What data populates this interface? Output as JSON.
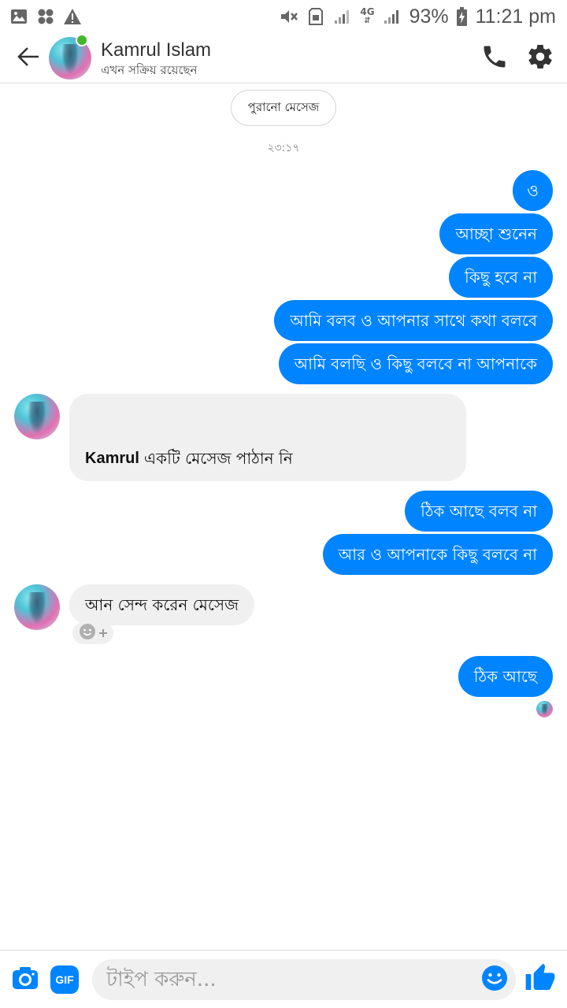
{
  "status_bar": {
    "battery": "93%",
    "time": "11:21 pm",
    "network": "4G",
    "icons": [
      "image-icon",
      "apps-icon",
      "warning-icon",
      "mute-icon",
      "sim-icon",
      "signal-icon",
      "signal-4g-icon",
      "battery-icon"
    ]
  },
  "header": {
    "name": "Kamrul Islam",
    "status": "এখন সক্রিয় রয়েছেন",
    "icons": [
      "back-arrow-icon",
      "phone-icon",
      "gear-icon"
    ]
  },
  "chat": {
    "older_messages_label": "পুরানো মেসেজ",
    "timestamp": "২৩:১৭",
    "messages": [
      {
        "text": "ও"
      },
      {
        "text": "আচ্ছা শুনেন"
      },
      {
        "text": "কিছু হবে না"
      },
      {
        "text": "আমি বলব ও আপনার সাথে কথা বলবে"
      },
      {
        "text": "আমি বলছি ও কিছু বলবে না আপনাকে"
      },
      {
        "name": "Kamrul",
        "text": "একটি মেসেজ পাঠান নি"
      },
      {
        "text": "ঠিক আছে বলব না"
      },
      {
        "text": "আর ও আপনাকে কিছু বলবে না"
      },
      {
        "text": "আন সেন্দ করেন মেসেজ"
      },
      {
        "text": "ঠিক আছে"
      }
    ]
  },
  "composer": {
    "placeholder": "টাইপ করুন...",
    "gif_label": "GIF",
    "icons": [
      "camera-icon",
      "gif-icon",
      "emoji-icon",
      "thumbs-up-icon"
    ]
  },
  "colors": {
    "accent": "#0084ff",
    "incoming_bubble": "#f1f0f0",
    "online": "#42b72a"
  }
}
